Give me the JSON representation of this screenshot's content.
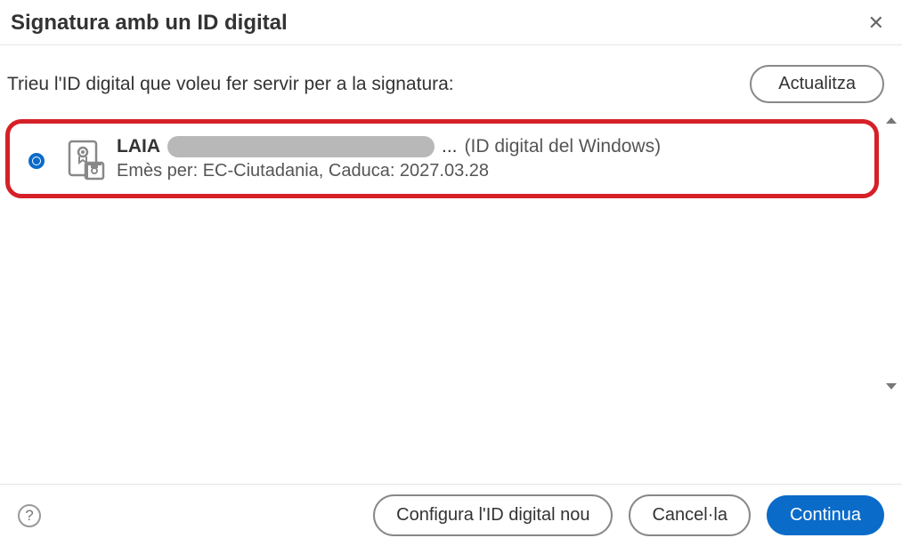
{
  "header": {
    "title": "Signatura amb un ID digital"
  },
  "instruction": "Trieu l'ID digital que voleu fer servir per a la signatura:",
  "refresh_label": "Actualitza",
  "certificate": {
    "name": "LAIA",
    "ellipsis": "...",
    "source": "(ID digital del Windows)",
    "details": "Emès per: EC-Ciutadania, Caduca: 2027.03.28"
  },
  "footer": {
    "help": "?",
    "configure": "Configura l'ID digital nou",
    "cancel": "Cancel·la",
    "continue": "Continua"
  }
}
